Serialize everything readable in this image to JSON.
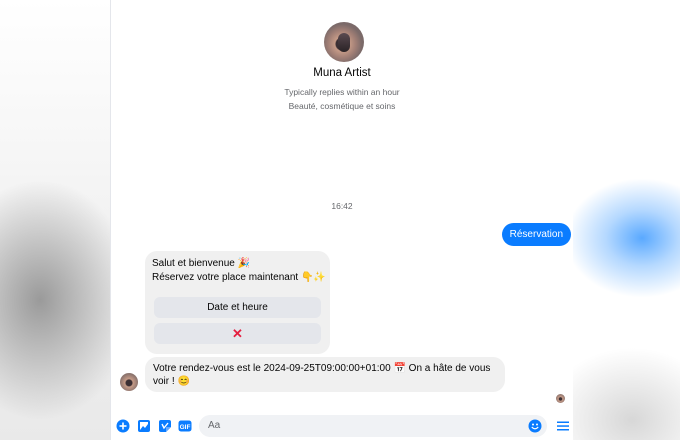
{
  "profile": {
    "name": "Muna Artist",
    "response_time": "Typically replies within an hour",
    "category": "Beauté, cosmétique et soins"
  },
  "conversation": {
    "timestamp": "16:42",
    "outgoing": [
      {
        "text": "Réservation"
      }
    ],
    "card": {
      "line1": "Salut et bienvenue 🎉",
      "line2": "Réservez votre place maintenant 👇✨",
      "buttons": [
        "Date et heure",
        "✕"
      ]
    },
    "confirmation": {
      "line1": "Votre rendez-vous est le 2024-09-25T09:00:00+01:00 📅 On a hâte de vous",
      "line2": "voir ! 😊"
    }
  },
  "composer": {
    "placeholder": "Aa",
    "icons": [
      "plus-icon",
      "gallery-icon",
      "sticker-icon",
      "gif-icon",
      "emoji-icon",
      "menu-icon"
    ],
    "gif_label": "GIF"
  },
  "colors": {
    "accent": "#0a7cff",
    "incoming_bubble": "#f0f0f0",
    "button": "#e4e6eb",
    "close": "#e41e3f"
  }
}
